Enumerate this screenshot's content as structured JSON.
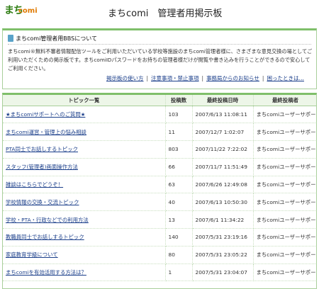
{
  "header": {
    "logo_mark": "まち",
    "logo_brand": "comi",
    "title": "まちcomi　管理者用掲示板"
  },
  "intro": {
    "heading": "まちcomi管理者用BBSについて",
    "text": "まちcomi®無料不審者情報配信ツールをご利用いただいている学校等施設のまちcomi管理者様に、さまざまな意見交換の場としてご利用いただくための掲示板です。まちcomiIDパスワードをお持ちの管理者様だけが閲覧や書き込みを行うことができるので安心してご利用ください。"
  },
  "links": [
    "掲示板の使い方",
    "注意事項・禁止事項",
    "事務局からのお知らせ",
    "困ったときは…"
  ],
  "table": {
    "headers": [
      "トピック一覧",
      "投稿数",
      "最終投稿日時",
      "最終投稿者"
    ],
    "rows": [
      {
        "topic": "★まちcomiサポートへのご質問★",
        "count": "103",
        "date": "2007/6/13 11:08:11",
        "author": "まちcomiユーザーサポート"
      },
      {
        "topic": "まちcomi運営・管理上の悩み相談",
        "count": "11",
        "date": "2007/12/7 1:02:07",
        "author": "まちcomiユーザーサポート"
      },
      {
        "topic": "PTA同士でお話しするトピック",
        "count": "803",
        "date": "2007/11/22 7:22:02",
        "author": "まちcomiユーザーサポート"
      },
      {
        "topic": "スタッフ(管理者)画面操作方法",
        "count": "66",
        "date": "2007/11/7 11:51:49",
        "author": "まちcomiユーザーサポート"
      },
      {
        "topic": "雑談はこちらでどうぞ！",
        "count": "63",
        "date": "2007/6/26 12:49:08",
        "author": "まちcomiユーザーサポート"
      },
      {
        "topic": "学校情報の交換・交流トピック",
        "count": "40",
        "date": "2007/6/13 10:50:30",
        "author": "まちcomiユーザーサポート"
      },
      {
        "topic": "学校・PTA・行政などでの利用方法",
        "count": "13",
        "date": "2007/6/1 11:34:22",
        "author": "まちcomiユーザーサポート"
      },
      {
        "topic": "教職員同士でお話しするトピック",
        "count": "140",
        "date": "2007/5/31 23:19:16",
        "author": "まちcomiユーザーサポート"
      },
      {
        "topic": "家庭教育学級について",
        "count": "80",
        "date": "2007/5/31 23:05:22",
        "author": "まちcomiユーザーサポート"
      },
      {
        "topic": "まちcomiを有効活用する方法は？",
        "count": "1",
        "date": "2007/5/31 23:04:07",
        "author": "まちcomiユーザーサポート"
      }
    ]
  }
}
